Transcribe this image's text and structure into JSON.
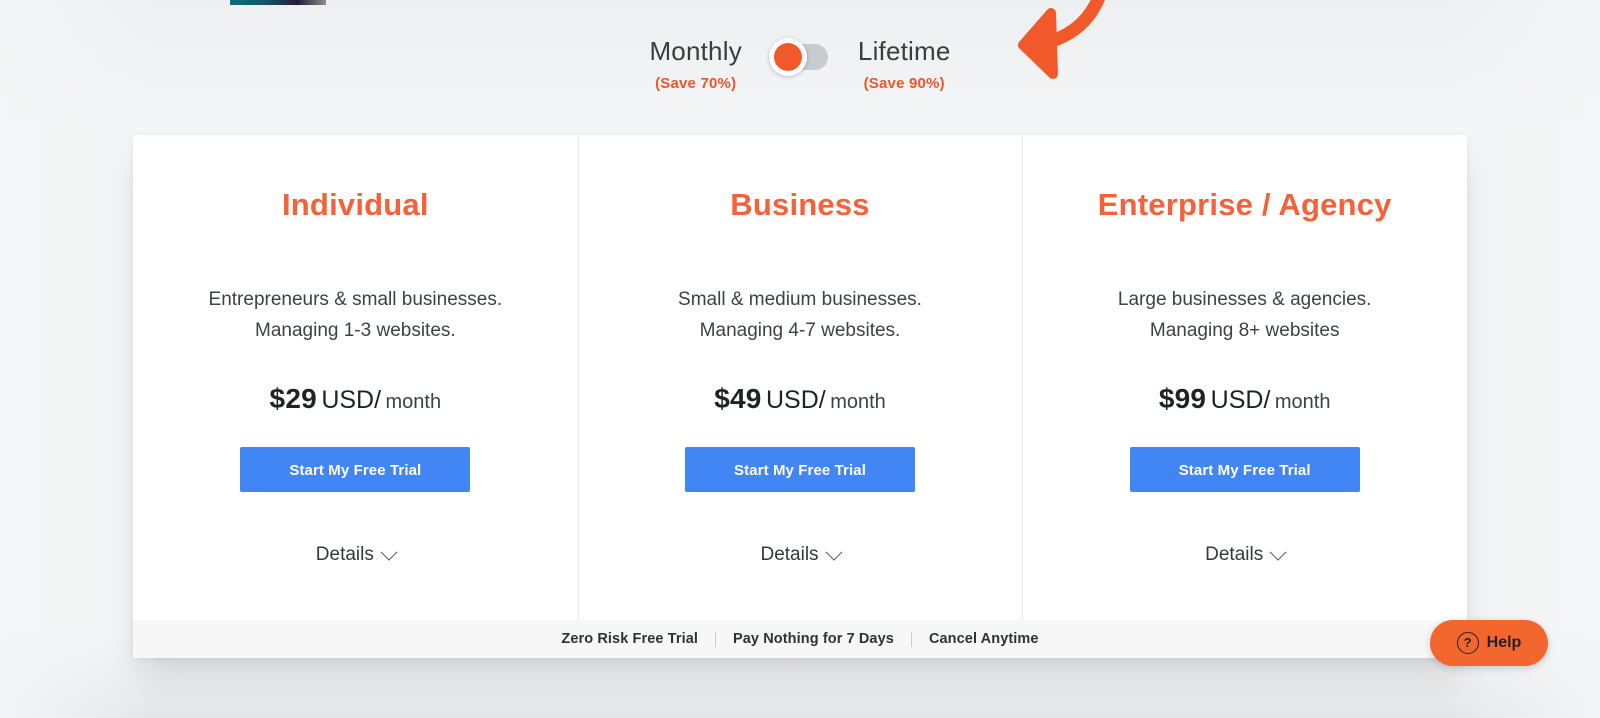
{
  "billing_toggle": {
    "left_label": "Monthly",
    "left_save": "(Save 70%)",
    "right_label": "Lifetime",
    "right_save": "(Save 90%)",
    "selected": "Monthly",
    "accent_color": "#f1592a",
    "track_color": "#c7ccd1"
  },
  "annotation": {
    "type": "curved-arrow",
    "color": "#f1592a",
    "points_to": "billing-toggle"
  },
  "plans": [
    {
      "name": "Individual",
      "description": "Entrepreneurs & small businesses.\nManaging 1-3 websites.",
      "price_amount": "$29",
      "price_currency": "USD/",
      "price_period": "month",
      "cta_label": "Start My Free Trial",
      "details_label": "Details"
    },
    {
      "name": "Business",
      "description": "Small & medium businesses.\nManaging 4-7 websites.",
      "price_amount": "$49",
      "price_currency": "USD/",
      "price_period": "month",
      "cta_label": "Start My Free Trial",
      "details_label": "Details"
    },
    {
      "name": "Enterprise / Agency",
      "description": "Large businesses & agencies.\nManaging 8+ websites",
      "price_amount": "$99",
      "price_currency": "USD/",
      "price_period": "month",
      "cta_label": "Start My Free Trial",
      "details_label": "Details"
    }
  ],
  "trust_bar": [
    "Zero Risk Free Trial",
    "Pay Nothing for 7 Days",
    "Cancel Anytime"
  ],
  "help_widget": {
    "label": "Help",
    "icon": "question-circle-icon",
    "background_color": "#f3662d"
  },
  "theme": {
    "brand_orange": "#f4613a",
    "cta_blue": "#4285f4",
    "page_background": "#f4f5f6",
    "card_background": "#ffffff",
    "trust_background": "#f7f7f8"
  }
}
